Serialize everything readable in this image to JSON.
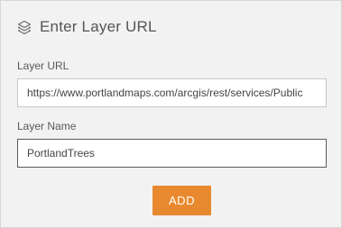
{
  "header": {
    "icon": "layers-icon",
    "title": "Enter Layer URL"
  },
  "url_field": {
    "label": "Layer URL",
    "value": "https://www.portlandmaps.com/arcgis/rest/services/Public"
  },
  "name_field": {
    "label": "Layer Name",
    "value": "PortlandTrees"
  },
  "add_button": {
    "label": "ADD",
    "color": "#e8892f"
  }
}
